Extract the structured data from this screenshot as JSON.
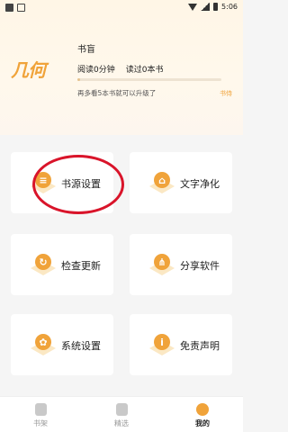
{
  "status_bar": {
    "time": "5:06"
  },
  "profile": {
    "logo_text": "几何",
    "username": "书盲",
    "read_time": "阅读0分钟",
    "books_read": "读过0本书",
    "progress_fraction": 0.02,
    "hint": "再多看5本书就可以升级了",
    "rank": "书侍"
  },
  "menu": [
    {
      "label": "书源设置",
      "icon": "book-source-icon"
    },
    {
      "label": "文字净化",
      "icon": "broom-icon"
    },
    {
      "label": "检查更新",
      "icon": "refresh-icon"
    },
    {
      "label": "分享软件",
      "icon": "share-icon"
    },
    {
      "label": "系统设置",
      "icon": "gear-icon"
    },
    {
      "label": "免责声明",
      "icon": "info-icon"
    }
  ],
  "tabs": [
    {
      "label": "书架",
      "icon": "bookshelf-icon"
    },
    {
      "label": "精选",
      "icon": "featured-icon"
    },
    {
      "label": "我的",
      "icon": "profile-icon"
    }
  ],
  "colors": {
    "accent": "#f0a33a",
    "annotation": "#d9142a"
  }
}
